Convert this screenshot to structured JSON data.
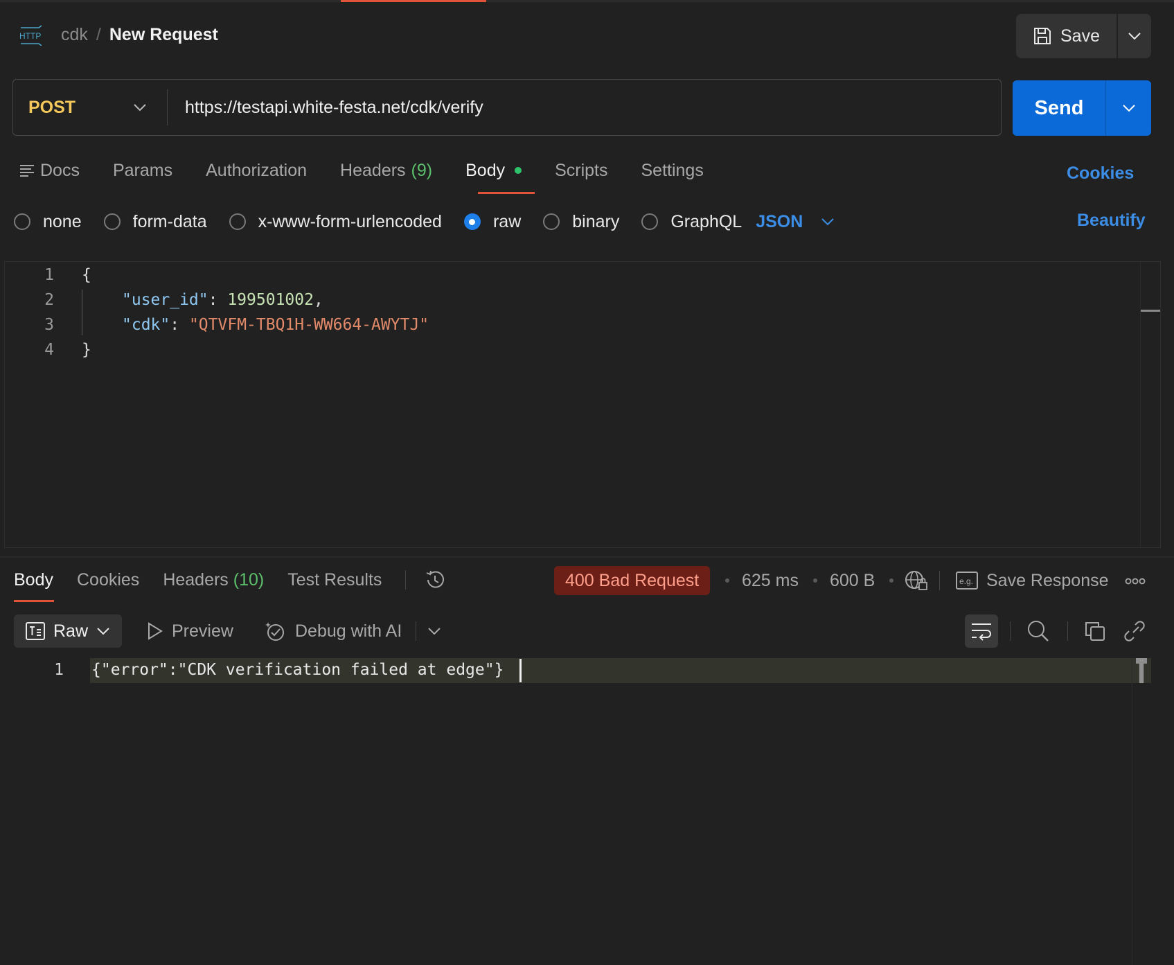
{
  "header": {
    "collection": "cdk",
    "separator": "/",
    "title": "New Request",
    "save_label": "Save"
  },
  "request": {
    "method": "POST",
    "url": "https://testapi.white-festa.net/cdk/verify",
    "send_label": "Send"
  },
  "request_tabs": [
    {
      "label": "Docs"
    },
    {
      "label": "Params"
    },
    {
      "label": "Authorization"
    },
    {
      "label": "Headers",
      "count": "(9)"
    },
    {
      "label": "Body",
      "active": true
    },
    {
      "label": "Scripts"
    },
    {
      "label": "Settings"
    }
  ],
  "cookies_label": "Cookies",
  "body_types": [
    {
      "label": "none",
      "selected": false
    },
    {
      "label": "form-data",
      "selected": false
    },
    {
      "label": "x-www-form-urlencoded",
      "selected": false
    },
    {
      "label": "raw",
      "selected": true
    },
    {
      "label": "binary",
      "selected": false
    },
    {
      "label": "GraphQL",
      "selected": false
    }
  ],
  "body_format": "JSON",
  "beautify_label": "Beautify",
  "editor": {
    "line_numbers": [
      "1",
      "2",
      "3",
      "4"
    ],
    "open_brace": "{",
    "close_brace": "}",
    "line2_key": "\"user_id\"",
    "line2_colon": ": ",
    "line2_value": "199501002",
    "line2_comma": ",",
    "line3_key": "\"cdk\"",
    "line3_colon": ": ",
    "line3_value": "\"QTVFM-TBQ1H-WW664-AWYTJ\""
  },
  "response": {
    "tabs": [
      {
        "label": "Body",
        "active": true
      },
      {
        "label": "Cookies"
      },
      {
        "label": "Headers",
        "count": "(10)"
      },
      {
        "label": "Test Results"
      }
    ],
    "status": "400 Bad Request",
    "time": "625 ms",
    "size": "600 B",
    "save_response_label": "Save Response",
    "view_mode": "Raw",
    "preview_label": "Preview",
    "debug_label": "Debug with AI",
    "line_number": "1",
    "body": "{\"error\":\"CDK verification failed at edge\"}"
  },
  "colors": {
    "accent_orange": "#e2543a",
    "send_blue": "#0b6ad8",
    "link_blue": "#3b8de6",
    "method_yellow": "#f4c85a",
    "status_error_bg": "#6b1f17",
    "count_green": "#5cbf6c"
  }
}
